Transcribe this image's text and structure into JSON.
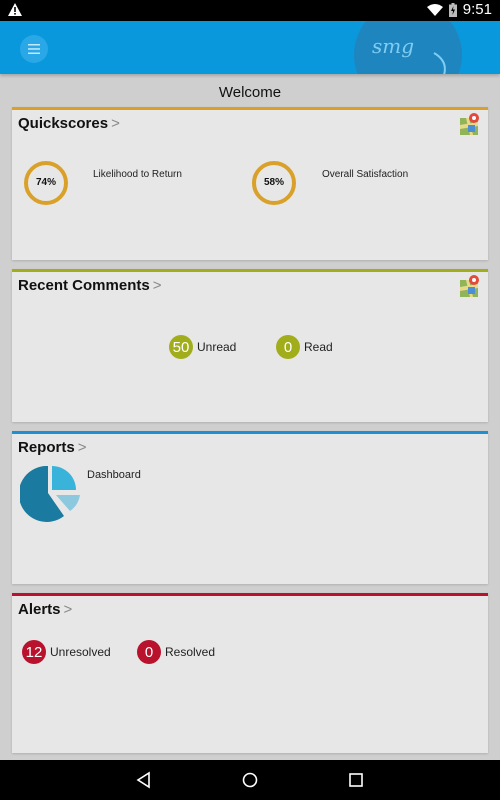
{
  "status_bar": {
    "time": "9:51",
    "icons": [
      "warning-icon",
      "wifi-icon",
      "battery-charging-icon"
    ]
  },
  "app_bar": {
    "menu_icon": "hamburger-menu-icon",
    "logo_text": "smg"
  },
  "page": {
    "title": "Welcome"
  },
  "colors": {
    "app_bar": "#0a98dc",
    "quickscores": "#d9a12a",
    "recent_comments": "#a2ad1c",
    "reports": "#1e8fcf",
    "alerts": "#b8122d"
  },
  "quickscores": {
    "title": "Quickscores",
    "chevron": ">",
    "icon": "map-pin-icon",
    "scores": [
      {
        "label": "Likelihood to Return",
        "value": "74%",
        "percent": 74
      },
      {
        "label": "Overall Satisfaction",
        "value": "58%",
        "percent": 58
      }
    ]
  },
  "recent_comments": {
    "title": "Recent Comments",
    "chevron": ">",
    "icon": "map-pin-icon",
    "unread": {
      "count": "50",
      "label": "Unread"
    },
    "read": {
      "count": "0",
      "label": "Read"
    }
  },
  "reports": {
    "title": "Reports",
    "chevron": ">",
    "items": [
      {
        "label": "Dashboard",
        "icon": "pie-chart-icon"
      }
    ]
  },
  "alerts": {
    "title": "Alerts",
    "chevron": ">",
    "unresolved": {
      "count": "12",
      "label": "Unresolved"
    },
    "resolved": {
      "count": "0",
      "label": "Resolved"
    }
  },
  "nav_bar": {
    "buttons": [
      "back-icon",
      "home-icon",
      "recents-icon"
    ]
  }
}
